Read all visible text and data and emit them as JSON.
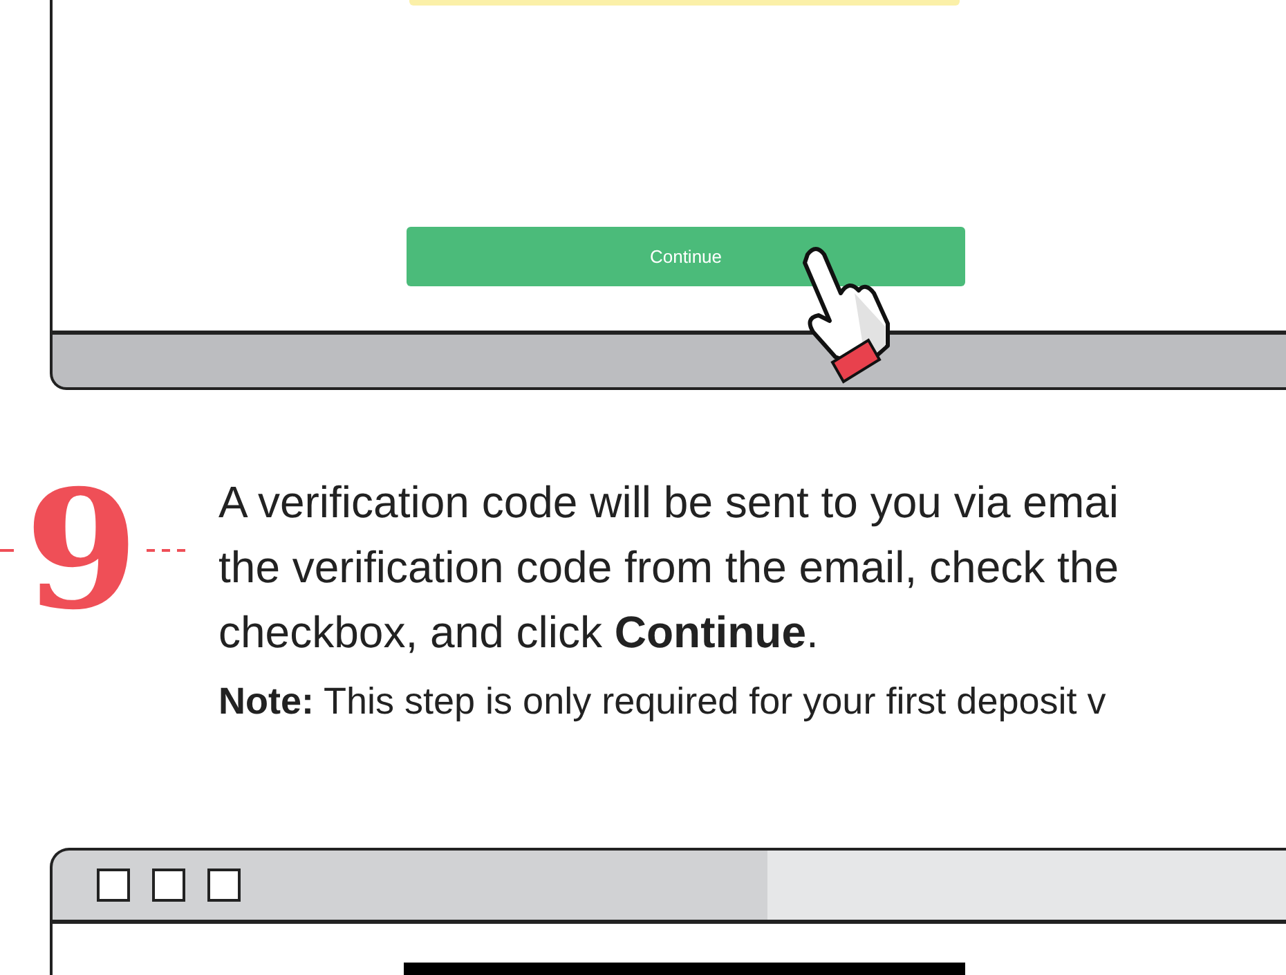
{
  "top_browser": {
    "button": "Continue"
  },
  "step": {
    "number": "9",
    "lines": [
      "A verification code will be sent to you via emai",
      "the verification code from the email, check the",
      "checkbox, and click **Continue**."
    ],
    "note": "**Note:** This step is only required for your first deposit v"
  }
}
